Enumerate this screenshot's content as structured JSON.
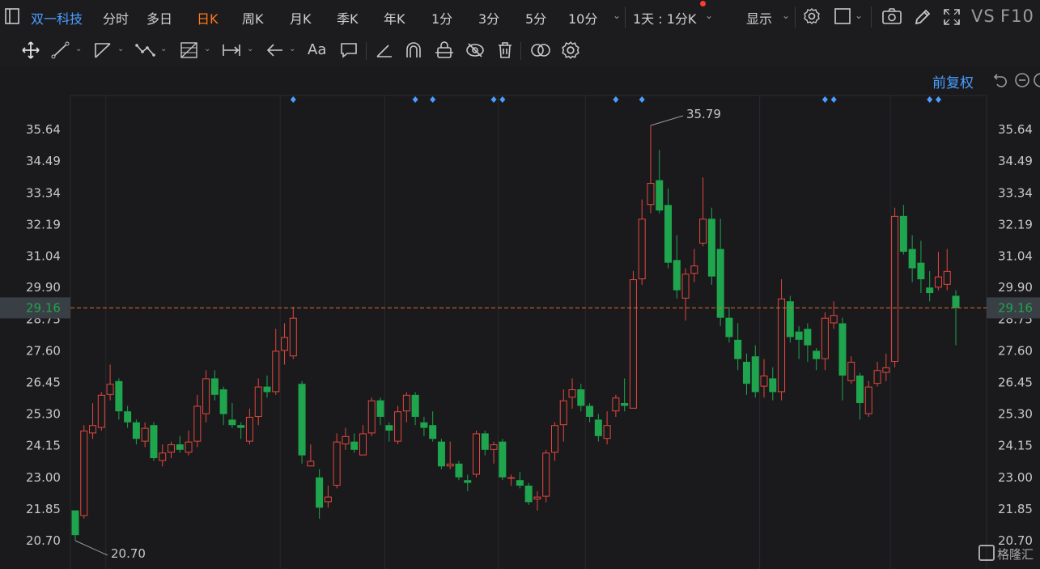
{
  "topbar": {
    "stock_name": "双一科技",
    "tabs": [
      "分时",
      "多日",
      "日K",
      "周K",
      "月K",
      "季K",
      "年K",
      "1分",
      "3分",
      "5分",
      "10分"
    ],
    "active_tab": 2,
    "period_selector": "1天 : 1分K",
    "display": "显示",
    "vs": "VS",
    "f10": "F10"
  },
  "chart_controls": {
    "adjust": "前复权"
  },
  "brand": "格隆汇",
  "colors": {
    "up": "#e5473d",
    "down": "#1ea54d",
    "accent": "#4a9eff",
    "active_tab": "#ff7a1a"
  },
  "chart_data": {
    "type": "candlestick",
    "ylim": [
      20.7,
      35.79
    ],
    "y_ticks": [
      "35.64",
      "34.49",
      "33.34",
      "32.19",
      "31.04",
      "29.90",
      "28.75",
      "27.60",
      "26.45",
      "25.30",
      "24.15",
      "23.00",
      "21.85",
      "20.70"
    ],
    "current_price": "29.16",
    "high_label": "35.79",
    "low_label": "20.70",
    "markers": [
      25,
      39,
      41,
      48,
      49,
      62,
      65,
      86,
      87,
      98,
      99
    ],
    "candles": [
      [
        21.8,
        20.9,
        21.8,
        20.7
      ],
      [
        21.6,
        24.7,
        24.9,
        21.5
      ],
      [
        24.6,
        24.9,
        25.7,
        24.4
      ],
      [
        24.8,
        26.0,
        26.1,
        24.7
      ],
      [
        26.0,
        26.4,
        27.1,
        25.8
      ],
      [
        26.5,
        25.4,
        26.6,
        25.1
      ],
      [
        25.4,
        25.0,
        25.6,
        24.8
      ],
      [
        25.0,
        24.4,
        25.1,
        24.2
      ],
      [
        24.3,
        24.8,
        25.0,
        24.1
      ],
      [
        24.9,
        23.7,
        25.0,
        23.6
      ],
      [
        23.6,
        23.9,
        24.2,
        23.4
      ],
      [
        23.9,
        24.2,
        24.3,
        23.7
      ],
      [
        24.2,
        24.0,
        24.5,
        23.9
      ],
      [
        23.9,
        24.3,
        24.7,
        23.8
      ],
      [
        24.3,
        25.6,
        26.0,
        24.1
      ],
      [
        25.3,
        26.6,
        26.9,
        25.0
      ],
      [
        26.6,
        26.0,
        26.9,
        25.8
      ],
      [
        26.2,
        25.3,
        26.3,
        24.9
      ],
      [
        25.1,
        24.9,
        25.7,
        24.8
      ],
      [
        24.9,
        24.8,
        25.0,
        24.4
      ],
      [
        24.3,
        25.2,
        25.5,
        24.2
      ],
      [
        25.2,
        26.3,
        26.6,
        24.9
      ],
      [
        26.3,
        26.1,
        26.7,
        25.9
      ],
      [
        26.1,
        27.6,
        28.4,
        26.0
      ],
      [
        27.6,
        28.1,
        28.6,
        27.1
      ],
      [
        27.4,
        28.8,
        29.2,
        27.3
      ],
      [
        26.4,
        23.8,
        26.5,
        23.5
      ],
      [
        23.4,
        23.6,
        24.2,
        23.5
      ],
      [
        23.0,
        21.9,
        23.3,
        21.5
      ],
      [
        22.1,
        22.3,
        22.7,
        21.9
      ],
      [
        22.7,
        24.3,
        24.6,
        22.6
      ],
      [
        24.2,
        24.5,
        24.8,
        24.0
      ],
      [
        24.3,
        24.0,
        24.6,
        23.9
      ],
      [
        23.8,
        24.6,
        24.9,
        23.8
      ],
      [
        24.6,
        25.8,
        25.9,
        24.5
      ],
      [
        25.8,
        25.2,
        25.9,
        24.9
      ],
      [
        24.9,
        24.7,
        25.0,
        24.3
      ],
      [
        24.3,
        25.4,
        25.6,
        24.2
      ],
      [
        25.4,
        26.0,
        26.1,
        25.0
      ],
      [
        26.0,
        25.2,
        26.1,
        24.9
      ],
      [
        25.0,
        24.8,
        25.2,
        24.5
      ],
      [
        24.9,
        24.4,
        25.4,
        24.3
      ],
      [
        24.3,
        23.4,
        24.4,
        23.3
      ],
      [
        23.4,
        23.5,
        24.3,
        23.3
      ],
      [
        23.5,
        23.0,
        23.6,
        22.9
      ],
      [
        22.9,
        22.8,
        23.1,
        22.5
      ],
      [
        23.1,
        24.6,
        24.7,
        23.0
      ],
      [
        24.6,
        24.0,
        24.7,
        23.8
      ],
      [
        24.0,
        24.2,
        24.3,
        23.5
      ],
      [
        24.3,
        23.0,
        24.4,
        22.9
      ],
      [
        23.0,
        23.0,
        23.1,
        22.7
      ],
      [
        22.9,
        22.7,
        23.2,
        22.6
      ],
      [
        22.7,
        22.1,
        22.8,
        22.0
      ],
      [
        22.2,
        22.3,
        22.5,
        21.8
      ],
      [
        22.3,
        23.9,
        24.0,
        22.1
      ],
      [
        23.9,
        24.9,
        25.0,
        23.6
      ],
      [
        24.9,
        25.8,
        26.2,
        24.3
      ],
      [
        25.9,
        26.2,
        26.6,
        25.5
      ],
      [
        26.2,
        25.6,
        26.4,
        25.4
      ],
      [
        25.6,
        25.2,
        25.7,
        25.0
      ],
      [
        25.1,
        24.5,
        25.3,
        24.3
      ],
      [
        24.4,
        24.9,
        25.4,
        24.2
      ],
      [
        25.4,
        25.9,
        26.0,
        25.2
      ],
      [
        25.7,
        25.6,
        26.6,
        25.4
      ],
      [
        25.5,
        30.2,
        30.5,
        25.5
      ],
      [
        30.2,
        32.4,
        33.1,
        30.0
      ],
      [
        32.9,
        33.7,
        35.79,
        32.6
      ],
      [
        33.8,
        32.7,
        34.9,
        32.6
      ],
      [
        32.9,
        30.8,
        33.5,
        30.6
      ],
      [
        30.9,
        29.8,
        31.8,
        29.5
      ],
      [
        29.5,
        30.4,
        30.6,
        28.7
      ],
      [
        30.4,
        30.7,
        31.3,
        30.1
      ],
      [
        31.5,
        32.4,
        33.9,
        31.4
      ],
      [
        32.4,
        30.3,
        32.8,
        30.0
      ],
      [
        31.3,
        28.8,
        32.4,
        28.5
      ],
      [
        28.8,
        28.1,
        29.2,
        27.9
      ],
      [
        28.0,
        27.3,
        28.6,
        26.9
      ],
      [
        27.2,
        26.4,
        27.5,
        26.0
      ],
      [
        27.4,
        26.1,
        27.8,
        25.9
      ],
      [
        26.3,
        26.7,
        27.3,
        25.9
      ],
      [
        26.6,
        26.1,
        27.0,
        25.8
      ],
      [
        26.1,
        29.5,
        30.2,
        25.8
      ],
      [
        29.4,
        28.1,
        29.6,
        27.9
      ],
      [
        28.3,
        28.0,
        28.5,
        27.3
      ],
      [
        28.4,
        27.8,
        28.6,
        27.2
      ],
      [
        27.6,
        27.3,
        27.7,
        26.9
      ],
      [
        27.3,
        28.8,
        29.0,
        26.9
      ],
      [
        28.6,
        28.9,
        29.4,
        28.4
      ],
      [
        28.6,
        26.7,
        28.8,
        25.8
      ],
      [
        26.5,
        27.2,
        27.4,
        26.4
      ],
      [
        26.7,
        25.7,
        26.8,
        25.1
      ],
      [
        25.3,
        26.3,
        26.5,
        25.2
      ],
      [
        26.4,
        26.9,
        27.2,
        26.3
      ],
      [
        26.8,
        27.0,
        27.5,
        26.5
      ],
      [
        27.2,
        32.5,
        32.8,
        27.0
      ],
      [
        32.5,
        31.2,
        32.9,
        31.1
      ],
      [
        31.3,
        30.6,
        31.8,
        30.1
      ],
      [
        30.8,
        30.2,
        31.6,
        29.7
      ],
      [
        29.9,
        29.7,
        30.5,
        29.4
      ],
      [
        29.9,
        30.3,
        31.2,
        29.8
      ],
      [
        30.0,
        30.5,
        31.3,
        29.8
      ],
      [
        29.6,
        29.16,
        29.8,
        27.8
      ]
    ]
  }
}
